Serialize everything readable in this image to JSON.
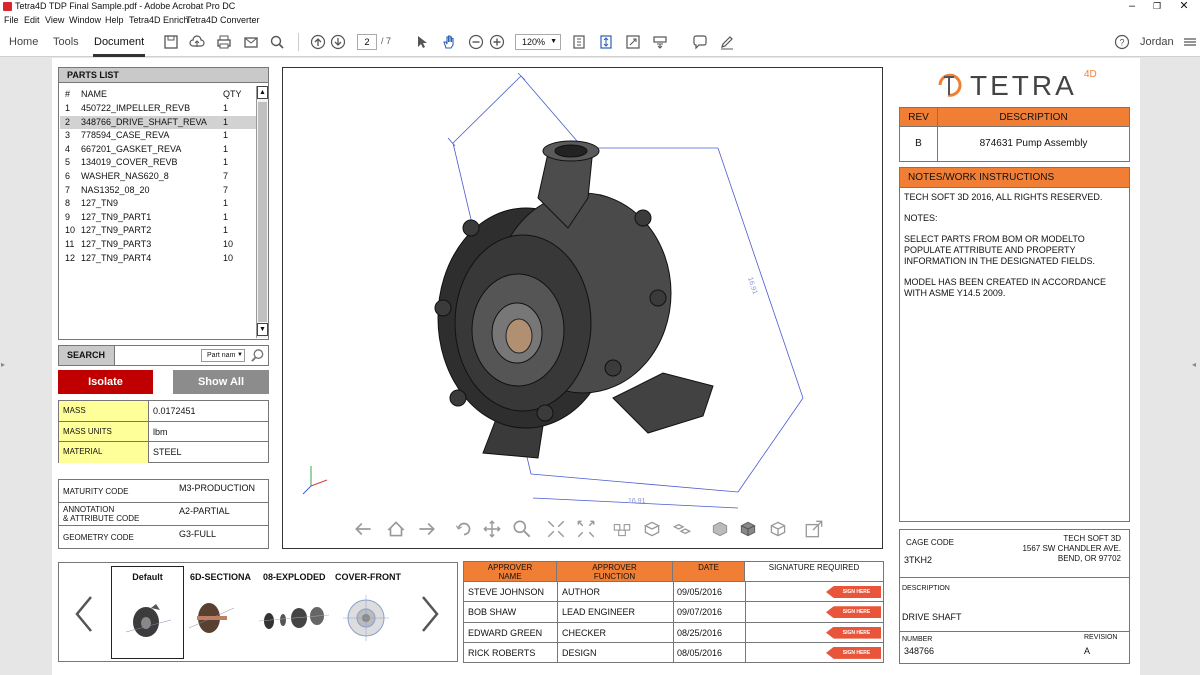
{
  "window": {
    "title": "Tetra4D TDP Final Sample.pdf - Adobe Acrobat Pro DC",
    "menu": [
      "File",
      "Edit",
      "View",
      "Window",
      "Help",
      "Tetra4D Enrich",
      "Tetra4D Converter"
    ]
  },
  "toolbar": {
    "tabs": [
      "Home",
      "Tools",
      "Document"
    ],
    "page_current": "2",
    "page_total": "/ 7",
    "zoom": "120%",
    "user": "Jordan"
  },
  "parts_list": {
    "title": "PARTS LIST",
    "col_num": "#",
    "col_name": "NAME",
    "col_qty": "QTY",
    "rows": [
      {
        "n": "1",
        "name": "450722_IMPELLER_REVB",
        "qty": "1"
      },
      {
        "n": "2",
        "name": "348766_DRIVE_SHAFT_REVA",
        "qty": "1"
      },
      {
        "n": "3",
        "name": "778594_CASE_REVA",
        "qty": "1"
      },
      {
        "n": "4",
        "name": "667201_GASKET_REVA",
        "qty": "1"
      },
      {
        "n": "5",
        "name": "134019_COVER_REVB",
        "qty": "1"
      },
      {
        "n": "6",
        "name": "WASHER_NAS620_8",
        "qty": "7"
      },
      {
        "n": "7",
        "name": "NAS1352_08_20",
        "qty": "7"
      },
      {
        "n": "8",
        "name": "127_TN9",
        "qty": "1"
      },
      {
        "n": "9",
        "name": "127_TN9_PART1",
        "qty": "1"
      },
      {
        "n": "10",
        "name": "127_TN9_PART2",
        "qty": "1"
      },
      {
        "n": "11",
        "name": "127_TN9_PART3",
        "qty": "10"
      },
      {
        "n": "12",
        "name": "127_TN9_PART4",
        "qty": "10"
      }
    ]
  },
  "search": {
    "label": "SEARCH",
    "select": "Part nam"
  },
  "buttons": {
    "isolate": "Isolate",
    "show_all": "Show All"
  },
  "properties": [
    {
      "label": "MASS",
      "value": "0.0172451"
    },
    {
      "label": "MASS UNITS",
      "value": "lbm"
    },
    {
      "label": "MATERIAL",
      "value": "STEEL"
    }
  ],
  "codes": [
    {
      "label": "MATURITY CODE",
      "value": "M3-PRODUCTION"
    },
    {
      "label": "ANNOTATION\n& ATTRIBUTE CODE",
      "value": "A2-PARTIAL"
    },
    {
      "label": "GEOMETRY CODE",
      "value": "G3-FULL"
    }
  ],
  "views": [
    "Default",
    "6D-SECTIONA",
    "08-EXPLODED",
    "COVER-FRONT"
  ],
  "viewer": {
    "dim1": "16.91",
    "dim2": "16.91"
  },
  "logo": {
    "text": "TETRA",
    "sup": "4D"
  },
  "rev_table": {
    "col_rev": "REV",
    "col_desc": "DESCRIPTION",
    "rev": "B",
    "desc": "874631 Pump Assembly"
  },
  "notes": {
    "title": "NOTES/WORK INSTRUCTIONS",
    "lines": [
      "TECH SOFT 3D 2016, ALL RIGHTS RESERVED.",
      "NOTES:",
      "SELECT PARTS  FROM BOM OR MODELTO POPULATE ATTRIBUTE AND PROPERTY INFORMATION IN THE DESIGNATED FIELDS.",
      "MODEL HAS BEEN CREATED IN ACCORDANCE WITH ASME Y14.5 2009."
    ]
  },
  "approvals": {
    "headers": [
      "APPROVER\nNAME",
      "APPROVER\nFUNCTION",
      "DATE",
      "SIGNATURE REQUIRED"
    ],
    "sign_label": "SIGN HERE",
    "rows": [
      {
        "name": "STEVE JOHNSON",
        "func": "AUTHOR",
        "date": "09/05/2016"
      },
      {
        "name": "BOB SHAW",
        "func": "LEAD ENGINEER",
        "date": "09/07/2016"
      },
      {
        "name": "EDWARD GREEN",
        "func": "CHECKER",
        "date": "08/25/2016"
      },
      {
        "name": "RICK ROBERTS",
        "func": "DESIGN",
        "date": "08/05/2016"
      }
    ]
  },
  "title_block": {
    "cage_label": "CAGE CODE",
    "cage_value": "3TKH2",
    "company": "TECH SOFT 3D",
    "addr1": "1567 SW CHANDLER AVE.",
    "addr2": "BEND, OR 97702",
    "desc_label": "DESCRIPTION",
    "desc_value": "DRIVE SHAFT",
    "number_label": "NUMBER",
    "number_value": "348766",
    "revision_label": "REVISION",
    "revision_value": "A"
  },
  "colors": {
    "accent": "#f07f35",
    "isolate": "#c00000",
    "show_all": "#8c8c8c",
    "highlight": "#ffff99"
  }
}
